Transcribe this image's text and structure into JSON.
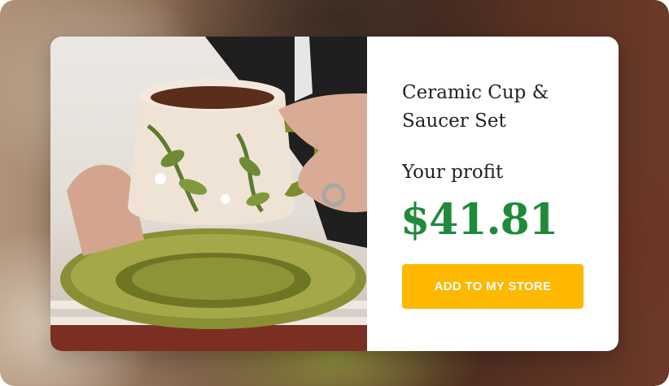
{
  "product": {
    "title": "Ceramic Cup & Saucer Set",
    "profit_label": "Your profit",
    "profit_value": "$41.81"
  },
  "actions": {
    "add_label": "ADD TO MY STORE"
  },
  "colors": {
    "price": "#1f8a3a",
    "button": "#ffb800",
    "cup_green": "#7f8b2f"
  }
}
